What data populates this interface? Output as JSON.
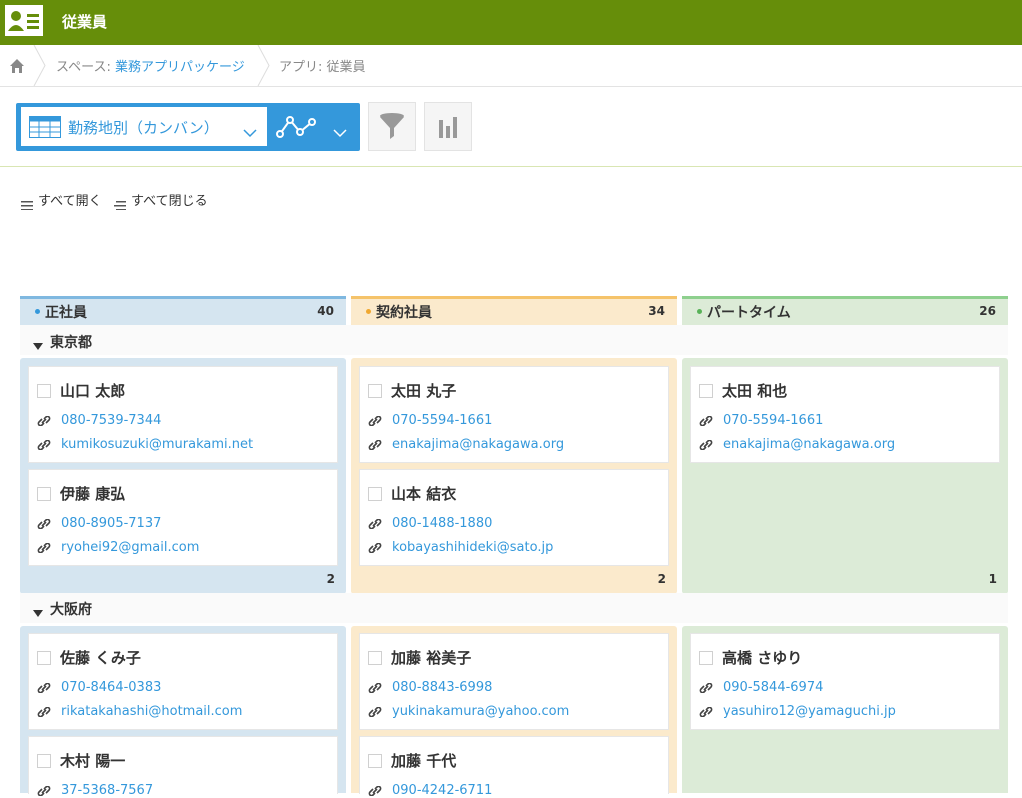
{
  "header": {
    "title": "従業員"
  },
  "breadcrumb": {
    "space_prefix": "スペース: ",
    "space_name": "業務アプリパッケージ",
    "app_label": "アプリ: 従業員"
  },
  "toolbar": {
    "view_name": "勤務地別（カンバン）"
  },
  "actions": {
    "expand_all": "すべて開く",
    "collapse_all": "すべて閉じる"
  },
  "columns": [
    {
      "title": "正社員",
      "count": "40",
      "color": "#d5e5f0",
      "dot": "#3498db",
      "top_border": "#7fb8e0"
    },
    {
      "title": "契約社員",
      "count": "34",
      "color": "#fbeacc",
      "dot": "#f0a830",
      "top_border": "#f5c36a"
    },
    {
      "title": "パートタイム",
      "count": "26",
      "color": "#dcebd7",
      "dot": "#58b258",
      "top_border": "#8ed08e"
    }
  ],
  "groups": [
    {
      "title": "東京都",
      "lane_counts": [
        "2",
        "2",
        "1"
      ],
      "lanes": [
        [
          {
            "name": "山口 太郎",
            "phone": "080-7539-7344",
            "email": "kumikosuzuki@murakami.net"
          },
          {
            "name": "伊藤 康弘",
            "phone": "080-8905-7137",
            "email": "ryohei92@gmail.com"
          }
        ],
        [
          {
            "name": "太田 丸子",
            "phone": "070-5594-1661",
            "email": "enakajima@nakagawa.org"
          },
          {
            "name": "山本 結衣",
            "phone": "080-1488-1880",
            "email": "kobayashihideki@sato.jp"
          }
        ],
        [
          {
            "name": "太田 和也",
            "phone": "070-5594-1661",
            "email": "enakajima@nakagawa.org"
          }
        ]
      ]
    },
    {
      "title": "大阪府",
      "lanes": [
        [
          {
            "name": "佐藤 くみ子",
            "phone": "070-8464-0383",
            "email": "rikatakahashi@hotmail.com"
          },
          {
            "name": "木村 陽一",
            "phone": "37-5368-7567",
            "email": ""
          }
        ],
        [
          {
            "name": "加藤 裕美子",
            "phone": "080-8843-6998",
            "email": "yukinakamura@yahoo.com"
          },
          {
            "name": "加藤 千代",
            "phone": "090-4242-6711",
            "email": ""
          }
        ],
        [
          {
            "name": "高橋 さゆり",
            "phone": "090-5844-6974",
            "email": "yasuhiro12@yamaguchi.jp"
          }
        ]
      ]
    }
  ],
  "icons": [
    "app-icon",
    "home-icon",
    "table-view-icon",
    "chevron-down-icon",
    "graph-icon",
    "filter-icon",
    "bar-chart-icon",
    "expand-icon",
    "collapse-icon",
    "link-icon",
    "triangle-down-icon"
  ]
}
